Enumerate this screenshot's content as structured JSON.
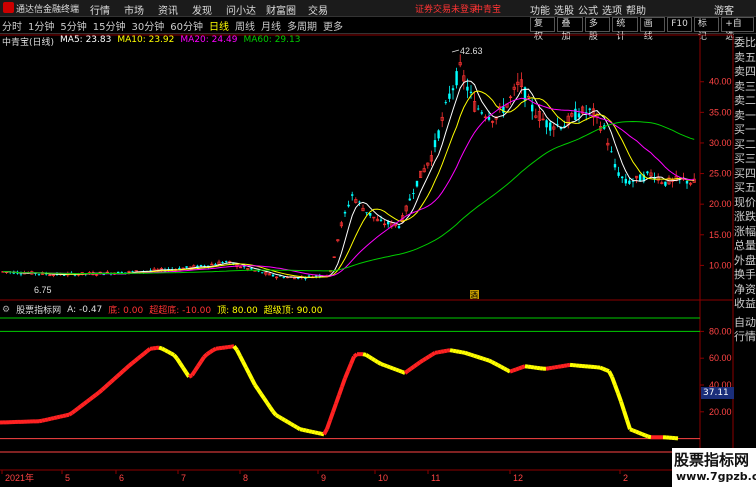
{
  "app": {
    "name": "通达信金融终端",
    "notice": "证券交易未登录",
    "stock_name": "中青宝",
    "guest": "游客"
  },
  "menu": [
    "行情",
    "市场",
    "资讯",
    "发现",
    "问小达",
    "财富圈",
    "交易"
  ],
  "right_menu": [
    "功能",
    "选股",
    "公式",
    "选项",
    "帮助"
  ],
  "periods": [
    {
      "label": "分时"
    },
    {
      "label": "1分钟"
    },
    {
      "label": "5分钟"
    },
    {
      "label": "15分钟"
    },
    {
      "label": "30分钟"
    },
    {
      "label": "60分钟"
    },
    {
      "label": "日线",
      "active": true
    },
    {
      "label": "周线"
    },
    {
      "label": "月线"
    },
    {
      "label": "多周期"
    },
    {
      "label": "更多"
    }
  ],
  "tools": [
    "复权",
    "叠加",
    "多股",
    "统计",
    "画线",
    "F10",
    "标记",
    "+自选"
  ],
  "main_legend": {
    "title": "中青宝(日线)",
    "ma5": "MA5: 23.83",
    "ma10": "MA10: 23.92",
    "ma20": "MA20: 24.49",
    "ma60": "MA60: 29.13"
  },
  "sub_legend": {
    "title": "股票指标网",
    "a": "A: -0.47",
    "di": "底: 0.00",
    "chaodi": "超超底: -10.00",
    "ding": "顶: 80.00",
    "chaoding": "超级顶: 90.00"
  },
  "colors": {
    "up": "#ff3333",
    "down": "#00ffff",
    "ma5": "#ffffff",
    "ma10": "#ffff00",
    "ma20": "#ff00ff",
    "ma60": "#00cc00",
    "osc_up": "#ff2222",
    "osc_down": "#ffff00",
    "grid": "#8b0000"
  },
  "price_axis": {
    "labels": [
      "40.00",
      "35.00",
      "30.00",
      "25.00",
      "20.00",
      "15.00",
      "10.00"
    ],
    "min": 5,
    "max": 46
  },
  "osc_axis": {
    "labels": [
      "80.00",
      "60.00",
      "40.00",
      "20.00"
    ],
    "current_value": "37.11"
  },
  "annotations": {
    "high": "42.63",
    "low": "6.75",
    "marker": "酒"
  },
  "date_axis": [
    "2021年",
    "5",
    "6",
    "7",
    "8",
    "9",
    "10",
    "11",
    "12",
    "2"
  ],
  "right_panel": [
    "委比",
    "卖五",
    "卖四",
    "卖三",
    "卖二",
    "卖一",
    "买一",
    "买二",
    "买三",
    "买四",
    "买五",
    "现价",
    "涨跌",
    "涨幅",
    "总量",
    "外盘",
    "换手",
    "净资",
    "收益"
  ],
  "right_panel_lower": [
    "自动",
    "行情"
  ],
  "watermark": {
    "line1": "股票指标网",
    "line2": "www.7gpzb.com"
  }
}
